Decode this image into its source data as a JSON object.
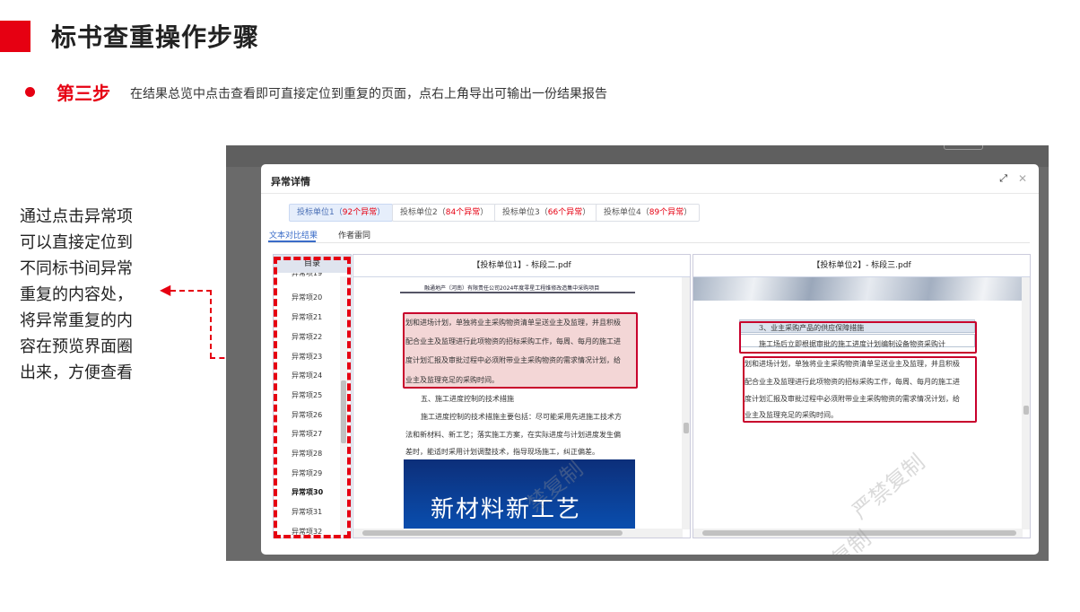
{
  "slide": {
    "title": "标书查重操作步骤",
    "step_label": "第三步",
    "step_desc": "在结果总览中点击查看即可直接定位到重复的页面，点右上角导出可输出一份结果报告",
    "note_lines": [
      "通过点击异常项",
      "可以直接定位到",
      "不同标书间异常",
      "重复的内容处，",
      "将异常重复的内",
      "容在预览界面圈",
      "出来，方便查看"
    ],
    "accent": "#e60012"
  },
  "dialog": {
    "title": "异常详情",
    "expand_icon": "expand-icon",
    "close_icon": "close-icon",
    "tabs": [
      {
        "name": "投标单位1",
        "open": "（",
        "count": "92个异常",
        "close": "）",
        "active": true
      },
      {
        "name": "投标单位2",
        "open": "（",
        "count": "84个异常",
        "close": "）",
        "active": false
      },
      {
        "name": "投标单位3",
        "open": "（",
        "count": "66个异常",
        "close": "）",
        "active": false
      },
      {
        "name": "投标单位4",
        "open": "（",
        "count": "89个异常",
        "close": "）",
        "active": false
      }
    ],
    "subtabs": [
      {
        "label": "文本对比结果",
        "active": true
      },
      {
        "label": "作者雷同",
        "active": false
      }
    ]
  },
  "sidebar": {
    "header": "目录",
    "items": [
      "异常项20",
      "异常项21",
      "异常项22",
      "异常项23",
      "异常项24",
      "异常项25",
      "异常项26",
      "异常项27",
      "异常项28",
      "异常项29",
      "异常项30",
      "异常项31",
      "异常项32"
    ],
    "selected": "异常项30"
  },
  "doc_left": {
    "header": "【投标单位1】- 标段二.pdf",
    "doc_title": "融通地产（河南）有限责任公司2024年度零星工程维修改造集中采购项目",
    "lines": [
      "划和进场计划，单独将业主采购物资清单呈送业主及监理，并且积极",
      "配合业主及监理进行此项物资的招标采购工作，每周、每月的施工进",
      "度计划汇报及审批过程中必须附带业主采购物资的需求情况计划，给",
      "业主及监理充足的采购时间。",
      "五、施工进度控制的技术措施",
      "施工进度控制的技术措施主要包括：尽可能采用先进施工技术方",
      "法和新材料、新工艺；落实施工方案，在实际进度与计划进度发生偏",
      "差时，能适时采用计划调整技术，指导现场施工，纠正偏差。"
    ],
    "banner_text": "新材料新工艺"
  },
  "doc_right": {
    "header": "【投标单位2】- 标段三.pdf",
    "table_rows": [
      "3、业主采购产品的供应保障措施",
      "施工场后立即根据审批的施工进度计划编制设备物资采购计"
    ],
    "lines": [
      "划和进场计划，单独将业主采购物资清单呈送业主及监理，并且积极",
      "配合业主及监理进行此项物资的招标采购工作，每周、每月的施工进",
      "度计划汇报及审批过程中必须附带业主采购物资的需求情况计划，给",
      "业主及监理充足的采购时间。"
    ]
  },
  "watermark": [
    "禁复制",
    "严禁复制",
    "严禁复制"
  ]
}
